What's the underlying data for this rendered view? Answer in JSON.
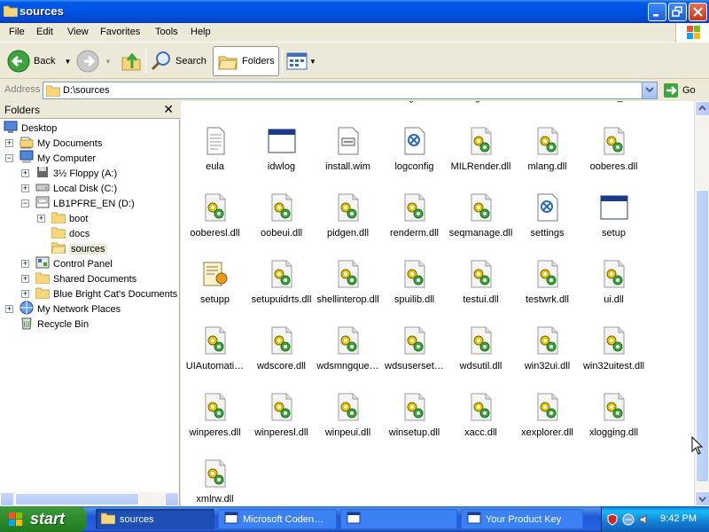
{
  "window": {
    "title": "sources",
    "menu": [
      "File",
      "Edit",
      "View",
      "Favorites",
      "Tools",
      "Help"
    ]
  },
  "toolbar": {
    "back_label": "Back",
    "search_label": "Search",
    "folders_label": "Folders"
  },
  "address": {
    "label": "Address",
    "value": "D:\\sources",
    "go_label": "Go"
  },
  "folders_pane": {
    "title": "Folders",
    "tree": [
      {
        "label": "Desktop",
        "icon": "desktop-icon"
      },
      {
        "label": "My Documents",
        "icon": "my-documents-icon"
      },
      {
        "label": "My Computer",
        "icon": "my-computer-icon"
      },
      {
        "label": "3½ Floppy (A:)",
        "icon": "floppy-icon"
      },
      {
        "label": "Local Disk (C:)",
        "icon": "local-disk-icon"
      },
      {
        "label": "LB1PFRE_EN (D:)",
        "icon": "cd-drive-icon"
      },
      {
        "label": "boot",
        "icon": "folder-icon"
      },
      {
        "label": "docs",
        "icon": "folder-icon"
      },
      {
        "label": "sources",
        "icon": "folder-open-icon"
      },
      {
        "label": "Control Panel",
        "icon": "control-panel-icon"
      },
      {
        "label": "Shared Documents",
        "icon": "folder-icon"
      },
      {
        "label": "Blue Bright Cat's Documents",
        "icon": "folder-icon"
      },
      {
        "label": "My Network Places",
        "icon": "network-places-icon"
      },
      {
        "label": "Recycle Bin",
        "icon": "recycle-bin-icon"
      }
    ]
  },
  "files": {
    "partial_row": [
      "mdiskmaxsm",
      "mdiskoldm",
      "mdiskmn",
      "background",
      "background",
      "button",
      "button_ion"
    ],
    "items": [
      {
        "name": "eula",
        "icon": "text-document-icon"
      },
      {
        "name": "idwlog",
        "icon": "application-window-icon"
      },
      {
        "name": "install.wim",
        "icon": "wim-file-icon"
      },
      {
        "name": "logconfig",
        "icon": "config-settings-icon"
      },
      {
        "name": "MILRender.dll",
        "icon": "dll-file-icon"
      },
      {
        "name": "mlang.dll",
        "icon": "dll-file-icon"
      },
      {
        "name": "ooberes.dll",
        "icon": "dll-file-icon"
      },
      {
        "name": "ooberesl.dll",
        "icon": "dll-file-icon"
      },
      {
        "name": "oobeui.dll",
        "icon": "dll-file-icon"
      },
      {
        "name": "pidgen.dll",
        "icon": "dll-file-icon"
      },
      {
        "name": "renderm.dll",
        "icon": "dll-file-icon"
      },
      {
        "name": "seqmanage.dll",
        "icon": "dll-file-icon"
      },
      {
        "name": "settings",
        "icon": "config-settings-icon"
      },
      {
        "name": "setup",
        "icon": "application-window-icon"
      },
      {
        "name": "setupp",
        "icon": "setup-package-icon"
      },
      {
        "name": "setupuidrts.dll",
        "icon": "dll-file-icon"
      },
      {
        "name": "shellinterop.dll",
        "icon": "dll-file-icon"
      },
      {
        "name": "spuilib.dll",
        "icon": "dll-file-icon"
      },
      {
        "name": "testui.dll",
        "icon": "dll-file-icon"
      },
      {
        "name": "testwrk.dll",
        "icon": "dll-file-icon"
      },
      {
        "name": "ui.dll",
        "icon": "dll-file-icon"
      },
      {
        "name": "UIAutomati…",
        "icon": "dll-file-icon"
      },
      {
        "name": "wdscore.dll",
        "icon": "dll-file-icon"
      },
      {
        "name": "wdsmngque…",
        "icon": "dll-file-icon"
      },
      {
        "name": "wdsuserset…",
        "icon": "dll-file-icon"
      },
      {
        "name": "wdsutil.dll",
        "icon": "dll-file-icon"
      },
      {
        "name": "win32ui.dll",
        "icon": "dll-file-icon"
      },
      {
        "name": "win32uitest.dll",
        "icon": "dll-file-icon"
      },
      {
        "name": "winperes.dll",
        "icon": "dll-file-icon"
      },
      {
        "name": "winperesl.dll",
        "icon": "dll-file-icon"
      },
      {
        "name": "winpeui.dll",
        "icon": "dll-file-icon"
      },
      {
        "name": "winsetup.dll",
        "icon": "dll-file-icon"
      },
      {
        "name": "xacc.dll",
        "icon": "dll-file-icon"
      },
      {
        "name": "xexplorer.dll",
        "icon": "dll-file-icon"
      },
      {
        "name": "xlogging.dll",
        "icon": "dll-file-icon"
      },
      {
        "name": "xmlrw.dll",
        "icon": "dll-file-icon"
      }
    ]
  },
  "taskbar": {
    "start_label": "start",
    "tasks": [
      {
        "label": "sources",
        "icon": "folder-icon",
        "active": true
      },
      {
        "label": "Microsoft Coden…",
        "icon": "application-window-icon",
        "active": false
      },
      {
        "label": "",
        "icon": "application-window-icon",
        "active": false
      },
      {
        "label": "Your Product Key",
        "icon": "application-window-icon",
        "active": false
      }
    ],
    "clock": "9:42 PM"
  },
  "colors": {
    "titlebar_blue": "#0054E3",
    "taskbar_blue": "#245EDC",
    "start_green": "#2D8B2D",
    "chrome": "#ECE9D8"
  }
}
